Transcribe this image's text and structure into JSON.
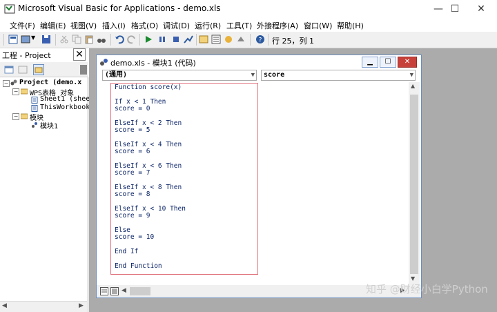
{
  "window": {
    "title": "Microsoft Visual Basic for Applications - demo.xls",
    "minimize": "—",
    "maximize": "☐",
    "close": "✕"
  },
  "menu": [
    "文件(F)",
    "编辑(E)",
    "视图(V)",
    "插入(I)",
    "格式(O)",
    "调试(D)",
    "运行(R)",
    "工具(T)",
    "外接程序(A)",
    "窗口(W)",
    "帮助(H)"
  ],
  "toolbar": {
    "position_text": "行 25，列 1"
  },
  "project_pane": {
    "title": "工程 - Project",
    "close": "✕",
    "tree": [
      {
        "label": "Project (demo.x",
        "bold": true
      },
      {
        "label": "WPS表格 对象"
      },
      {
        "label": "Sheet1 (shee"
      },
      {
        "label": "ThisWorkbook"
      },
      {
        "label": "模块"
      },
      {
        "label": "模块1"
      }
    ]
  },
  "code_window": {
    "title": "demo.xls - 模块1 (代码)",
    "object_combo": "(通用)",
    "proc_combo": "score",
    "lines": [
      "Function score(x)",
      "",
      "If x < 1 Then",
      "score = 0",
      "",
      "ElseIf x < 2 Then",
      "score = 5",
      "",
      "ElseIf x < 4 Then",
      "score = 6",
      "",
      "ElseIf x < 6 Then",
      "score = 7",
      "",
      "ElseIf x < 8 Then",
      "score = 8",
      "",
      "ElseIf x < 10 Then",
      "score = 9",
      "",
      "Else",
      "score = 10",
      "",
      "End If",
      "",
      "End Function"
    ]
  },
  "watermark": "知乎 @财经小白学Python",
  "colors": {
    "highlight_box": "#e0707a",
    "mdi_bg": "#ababab"
  }
}
